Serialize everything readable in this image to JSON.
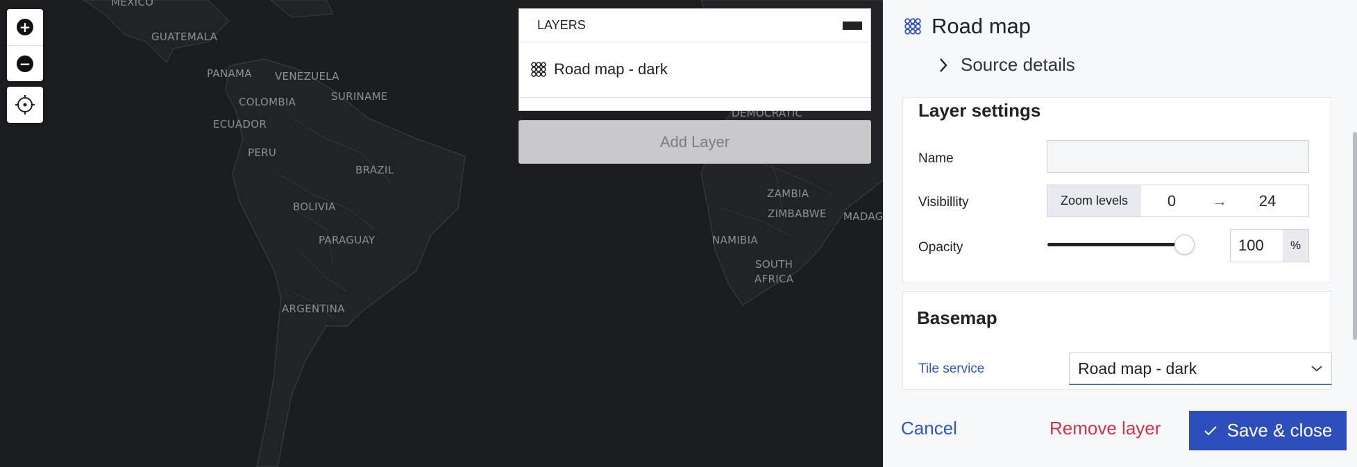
{
  "map": {
    "labels": {
      "mexico": "MEXICO",
      "guatemala": "GUATEMALA",
      "panama": "PANAMA",
      "venezuela": "VENEZUELA",
      "colombia": "COLOMBIA",
      "suriname": "SURINAME",
      "ecuador": "ECUADOR",
      "peru": "PERU",
      "brazil": "BRAZIL",
      "bolivia": "BOLIVIA",
      "paraguay": "PARAGUAY",
      "argentina": "ARGENTINA",
      "democratic": "DEMOCRATIC",
      "zambia": "ZAMBIA",
      "zimbabwe": "ZIMBABWE",
      "madagascar": "MADAG",
      "namibia": "NAMIBIA",
      "south": "SOUTH",
      "africa": "AFRICA"
    },
    "background_color": "#1c1d20",
    "land_color": "#222327"
  },
  "layers_panel": {
    "title": "LAYERS",
    "items": [
      {
        "label": "Road map - dark",
        "icon": "grid-icon"
      }
    ],
    "add_layer_label": "Add Layer"
  },
  "sidebar": {
    "title": "Road map",
    "source_details_label": "Source details",
    "layer_settings": {
      "title": "Layer settings",
      "name_label": "Name",
      "name_value": "",
      "visibility_label": "Visibillity",
      "zoom_levels_tag": "Zoom levels",
      "zoom_min": "0",
      "zoom_arrow": "→",
      "zoom_max": "24",
      "opacity_label": "Opacity",
      "opacity_value": "100",
      "opacity_unit": "%",
      "opacity_slider_fraction": 1.0
    },
    "basemap": {
      "title": "Basemap",
      "tile_service_label": "Tile service",
      "tile_service_value": "Road map - dark"
    },
    "footer": {
      "cancel_label": "Cancel",
      "remove_label": "Remove layer",
      "save_label": "Save & close"
    }
  },
  "colors": {
    "accent": "#2e4fbb",
    "link": "#2e55c5",
    "danger": "#d2314a"
  }
}
